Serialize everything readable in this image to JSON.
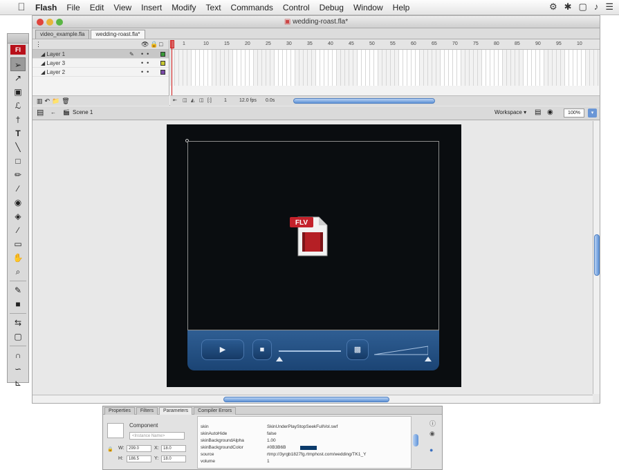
{
  "menubar": {
    "app": "Flash",
    "items": [
      "File",
      "Edit",
      "View",
      "Insert",
      "Modify",
      "Text",
      "Commands",
      "Control",
      "Debug",
      "Window",
      "Help"
    ]
  },
  "window": {
    "title": "wedding-roast.fla*",
    "tabs": [
      "video_example.fla",
      "wedding-roast.fla*"
    ]
  },
  "tools": {
    "badge": "Fl",
    "items": [
      "selection",
      "subselection",
      "free-transform",
      "lasso",
      "pen",
      "text",
      "line",
      "rectangle",
      "pencil",
      "brush",
      "ink-bottle",
      "paint-bucket",
      "eyedropper",
      "eraser",
      "hand",
      "zoom",
      "stroke-color",
      "fill-color",
      "swap-colors",
      "snap",
      "smooth",
      "straighten"
    ]
  },
  "timeline": {
    "layers": [
      {
        "name": "Layer 1",
        "selected": true,
        "color": "#3a9a3a"
      },
      {
        "name": "Layer 3",
        "selected": false,
        "color": "#c8c832"
      },
      {
        "name": "Layer 2",
        "selected": false,
        "color": "#7a4aa8"
      }
    ],
    "frame_labels": [
      "1",
      "10",
      "15",
      "20",
      "25",
      "30",
      "35",
      "40",
      "45",
      "50",
      "55",
      "60",
      "65",
      "70",
      "75",
      "80",
      "85",
      "90",
      "95",
      "10"
    ],
    "frame_number": "1",
    "fps": "12.0 fps",
    "elapsed": "0.0s"
  },
  "editbar": {
    "scene": "Scene 1",
    "workspace": "Workspace",
    "zoom": "100%"
  },
  "stage": {
    "placeholder_label": "FLV"
  },
  "inspector": {
    "tabs": [
      "Properties",
      "Filters",
      "Parameters",
      "Compiler Errors"
    ],
    "active_tab": "Parameters",
    "component_label": "Component",
    "instance_placeholder": "<Instance Name>",
    "w": "299.0",
    "x": "18.0",
    "h": "186.5",
    "y": "18.0",
    "params": [
      {
        "name": "skin",
        "value": "SkinUnderPlayStopSeekFullVol.swf"
      },
      {
        "name": "skinAutoHide",
        "value": "false"
      },
      {
        "name": "skinBackgroundAlpha",
        "value": "1.00"
      },
      {
        "name": "skinBackgroundColor",
        "value": "#0B3B6B"
      },
      {
        "name": "source",
        "value": "rtmp://3yrgb1827fg.rtmphost.com/wedding/TK1_Y"
      },
      {
        "name": "volume",
        "value": "1"
      }
    ],
    "skin_color": "#0B3B6B"
  }
}
